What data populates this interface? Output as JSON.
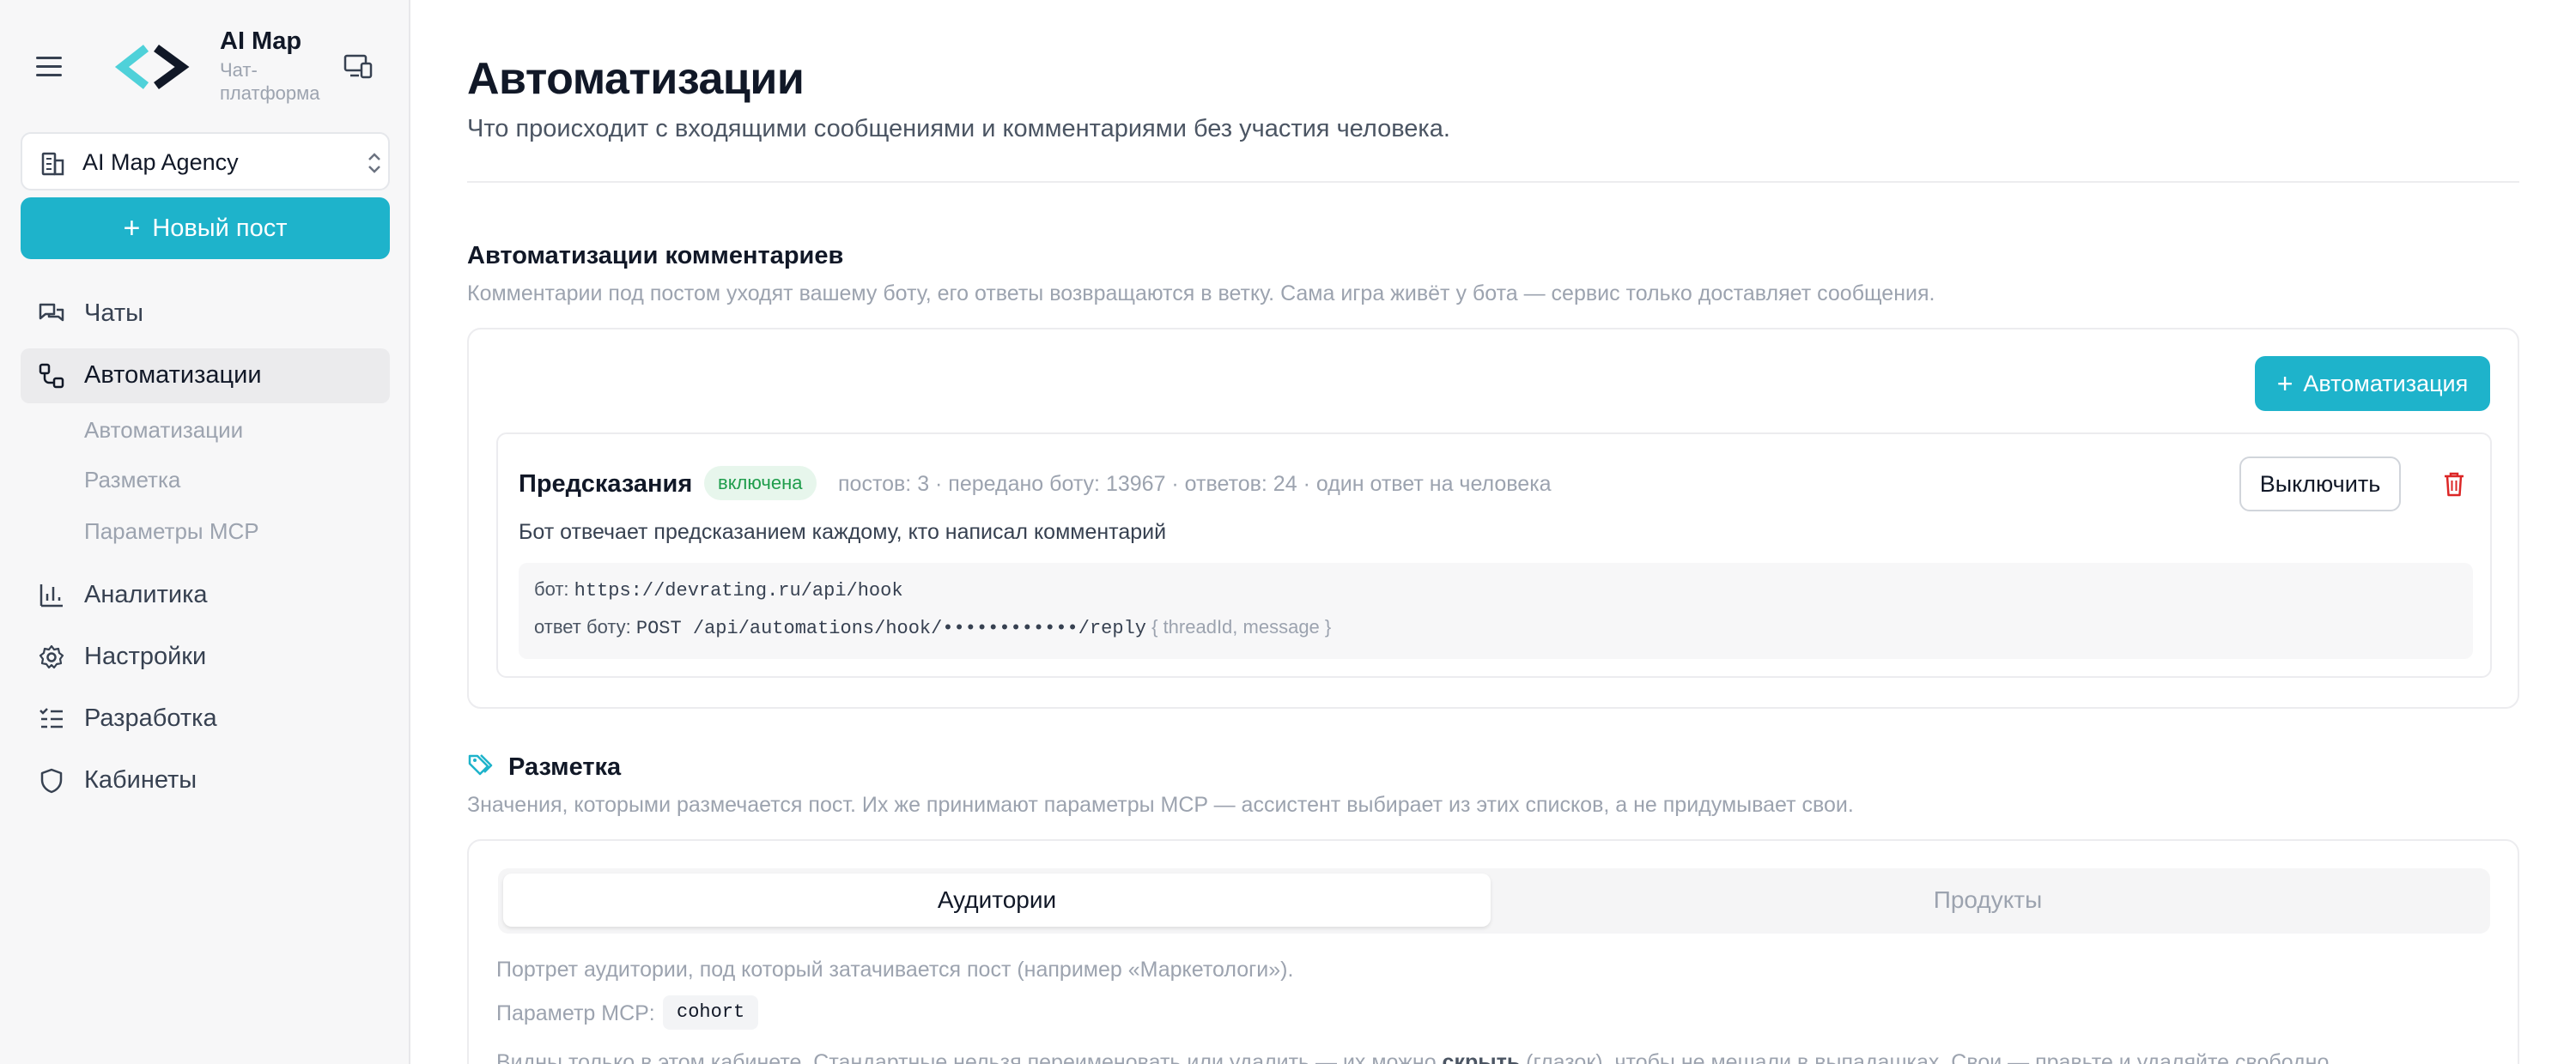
{
  "sidebar": {
    "brand_name": "AI Map",
    "brand_subtitle": "Чат-платформа",
    "workspace": "AI Map Agency",
    "new_post_label": "Новый пост",
    "items": [
      {
        "label": "Чаты",
        "icon": "chat-icon"
      },
      {
        "label": "Автоматизации",
        "icon": "workflow-icon",
        "active": true
      },
      {
        "label": "Аналитика",
        "icon": "bar-chart-icon"
      },
      {
        "label": "Настройки",
        "icon": "gear-icon"
      },
      {
        "label": "Разработка",
        "icon": "code-list-icon"
      },
      {
        "label": "Кабинеты",
        "icon": "shield-icon"
      }
    ],
    "subitems": [
      "Автоматизации",
      "Разметка",
      "Параметры MCP"
    ]
  },
  "page": {
    "title": "Автоматизации",
    "subtitle": "Что происходит с входящими сообщениями и комментариями без участия человека."
  },
  "comments_section": {
    "title": "Автоматизации комментариев",
    "description": "Комментарии под постом уходят вашему боту, его ответы возвращаются в ветку. Сама игра живёт у бота — сервис только доставляет сообщения.",
    "add_button": "Автоматизация",
    "automation": {
      "name": "Предсказания",
      "status": "включена",
      "meta": "постов: 3 · передано боту: 13967 · ответов: 24 · один ответ на человека",
      "toggle_label": "Выключить",
      "description": "Бот отвечает предсказанием каждому, кто написал комментарий",
      "bot_label": "бот:",
      "bot_url": "https://devrating.ru/api/hook",
      "reply_label": "ответ боту:",
      "reply_endpoint": "POST /api/automations/hook/••••••••••••/reply",
      "reply_hint": "{ threadId, message }"
    }
  },
  "markup_section": {
    "title": "Разметка",
    "description": "Значения, которыми размечается пост. Их же принимают параметры MCP — ассистент выбирает из этих списков, а не придумывает свои.",
    "tabs": [
      {
        "label": "Аудитории",
        "active": true
      },
      {
        "label": "Продукты",
        "active": false
      }
    ],
    "tab_description": "Портрет аудитории, под который затачивается пост (например «Маркетологи»).",
    "param_label": "Параметр MCP:",
    "param_value": "cohort",
    "note_start": "Видны только в этом кабинете. Стандартные нельзя переименовать или удалить — их можно ",
    "note_bold": "скрыть",
    "note_end": " (глазок), чтобы не мешали в выпадашках. Свои — правьте и удаляйте свободно."
  },
  "colors": {
    "accent": "#1eb3cb",
    "success_bg": "#e7f6ec",
    "success_text": "#1f9d4c",
    "danger": "#dc2626"
  }
}
